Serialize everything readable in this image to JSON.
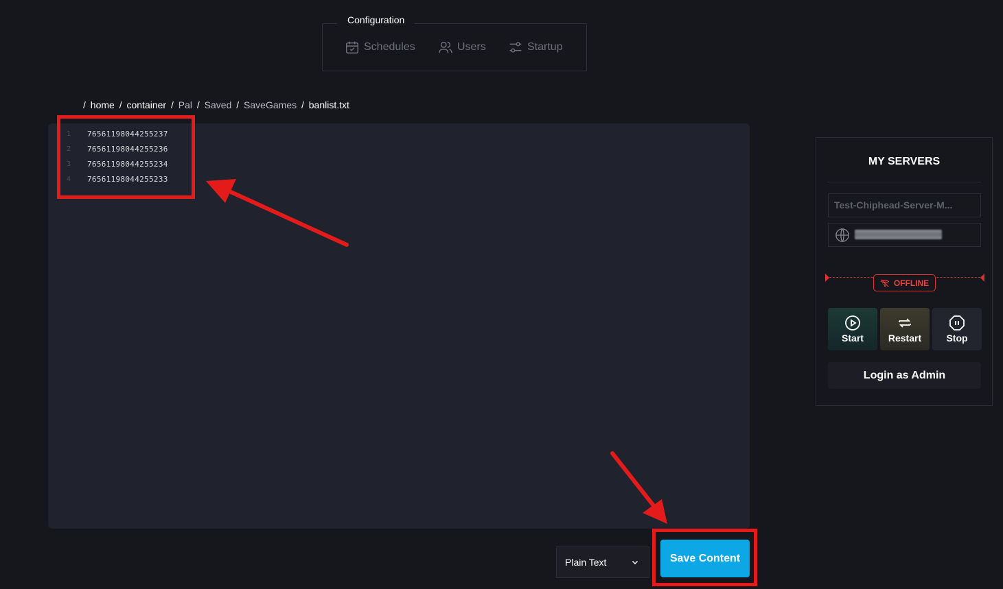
{
  "config": {
    "legend": "Configuration",
    "nav": [
      {
        "label": "Schedules",
        "icon": "calendar-check-icon"
      },
      {
        "label": "Users",
        "icon": "users-icon"
      },
      {
        "label": "Startup",
        "icon": "sliders-icon"
      }
    ]
  },
  "breadcrumb": {
    "separator": "/",
    "items": [
      "home",
      "container",
      "Pal",
      "Saved",
      "SaveGames",
      "banlist.txt"
    ]
  },
  "editor": {
    "lines": [
      {
        "number": "1",
        "text": "76561198044255237"
      },
      {
        "number": "2",
        "text": "76561198044255236"
      },
      {
        "number": "3",
        "text": "76561198044255234"
      },
      {
        "number": "4",
        "text": "76561198044255233"
      }
    ]
  },
  "footer": {
    "language": "Plain Text",
    "save_label": "Save Content"
  },
  "servers": {
    "title": "MY SERVERS",
    "server_name": "Test-Chiphead-Server-M...",
    "status": "OFFLINE",
    "start_label": "Start",
    "restart_label": "Restart",
    "stop_label": "Stop",
    "login_label": "Login as Admin"
  },
  "colors": {
    "background": "#16161d",
    "editor_bg": "#20232d",
    "accent": "#0ea7e6",
    "annotation": "#e31b1b",
    "offline": "#e03030"
  }
}
